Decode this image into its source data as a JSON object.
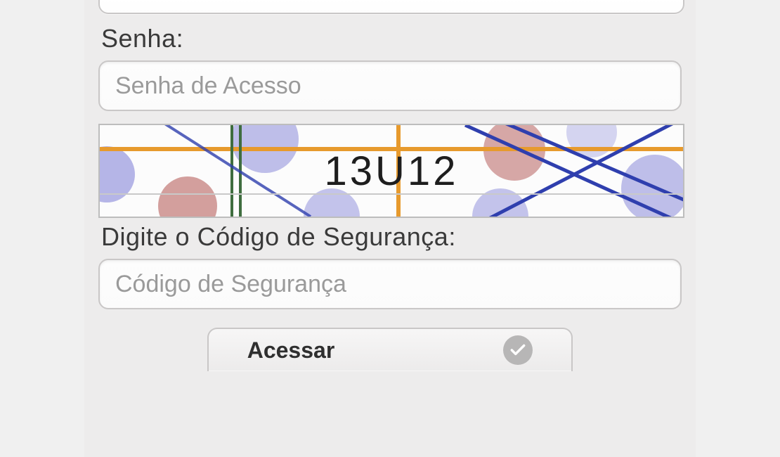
{
  "form": {
    "password_label": "Senha:",
    "password_placeholder": "Senha de Acesso",
    "captcha_value": "13U12",
    "captcha_label": "Digite o Código de Segurança:",
    "captcha_placeholder": "Código de Segurança",
    "submit_label": "Acessar"
  }
}
